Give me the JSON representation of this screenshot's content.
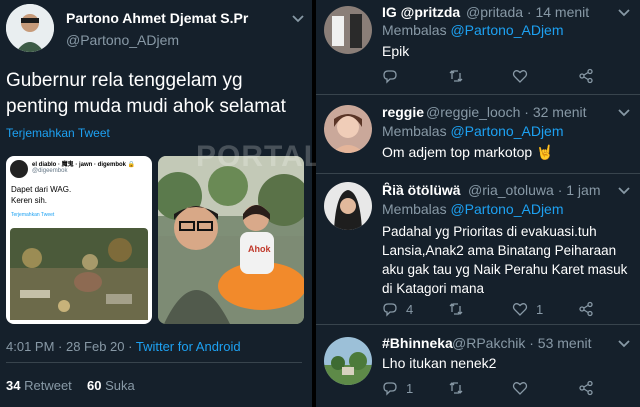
{
  "watermark": "PORTAL-ISLAM.ID",
  "main_tweet": {
    "author_name": "Partono Ahmet Djemat S.Pr",
    "handle": "@Partono_ADjem",
    "text_line1": "Gubernur rela tenggelam yg",
    "text_line2": "penting muda mudi ahok selamat",
    "translate": "Terjemahkan Tweet",
    "embedded": {
      "author": "el diablo · 魔鬼 · jawn · digembok 🔒",
      "handle": "@digeembok",
      "line1": "Dapet dari WAG.",
      "line2": "Keren sih.",
      "translate": "Terjemahkan Tweet"
    },
    "photo_caption": "Ahok",
    "timestamp": "4:01 PM · 28 Feb 20 · ",
    "client": "Twitter for Android",
    "retweet_count": "34",
    "retweet_label": "Retweet",
    "like_count": "60",
    "like_label": "Suka"
  },
  "replies": [
    {
      "name": "IG @pritzda",
      "handle": "@pritada",
      "time": "· 14 menit",
      "replying_to": "Membalas ",
      "replying_handle": "@Partono_ADjem",
      "text_lines": [
        "Epik"
      ],
      "reply_count": "",
      "retweet_count": "",
      "like_count": ""
    },
    {
      "name": "reggie",
      "handle": "@reggie_looch",
      "time": "· 32 menit",
      "replying_to": "Membalas ",
      "replying_handle": "@Partono_ADjem",
      "text_lines": [
        "Om adjem top markotop 🤘"
      ],
      "reply_count": "",
      "retweet_count": "",
      "like_count": ""
    },
    {
      "name": "Ȓiȁ ötölüwä",
      "handle": "@ria_otoluwa",
      "time": "· 1 jam",
      "replying_to": "Membalas ",
      "replying_handle": "@Partono_ADjem",
      "text_lines": [
        "Padahal yg Prioritas di evakuasi.tuh",
        "Lansia,Anak2 ama Binatang Peiharaan",
        "aku gak tau yg Naik Perahu Karet masuk",
        "di Katagori mana"
      ],
      "reply_count": "4",
      "retweet_count": "",
      "like_count": "1"
    },
    {
      "name": "#Bhinneka",
      "handle": "@RPakchik",
      "time": "· 53 menit",
      "replying_to": "",
      "replying_handle": "",
      "text_lines": [
        "Lho itukan nenek2"
      ],
      "reply_count": "1",
      "retweet_count": "",
      "like_count": ""
    }
  ]
}
